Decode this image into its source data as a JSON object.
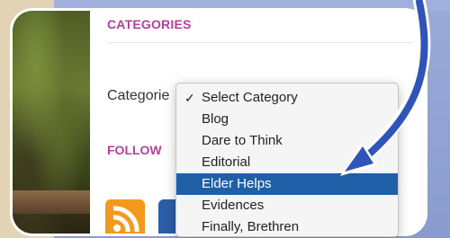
{
  "categories_section": {
    "heading": "CATEGORIES",
    "select_label": "Categorie"
  },
  "follow_section": {
    "heading": "FOLLOW"
  },
  "dropdown": {
    "options": [
      {
        "label": "Select Category",
        "checked": true
      },
      {
        "label": "Blog"
      },
      {
        "label": "Dare to Think"
      },
      {
        "label": "Editorial"
      },
      {
        "label": "Elder Helps",
        "highlighted": true
      },
      {
        "label": "Evidences"
      },
      {
        "label": "Finally, Brethren"
      }
    ],
    "check_mark": "✓"
  },
  "colors": {
    "heading": "#b43fa0",
    "highlight": "#1f5fa8",
    "arrow": "#2f55b8",
    "rss": "#f39a1d",
    "social_blue": "#2b5ea9"
  },
  "icons": {
    "rss": "rss-icon",
    "social": "social-icon"
  }
}
